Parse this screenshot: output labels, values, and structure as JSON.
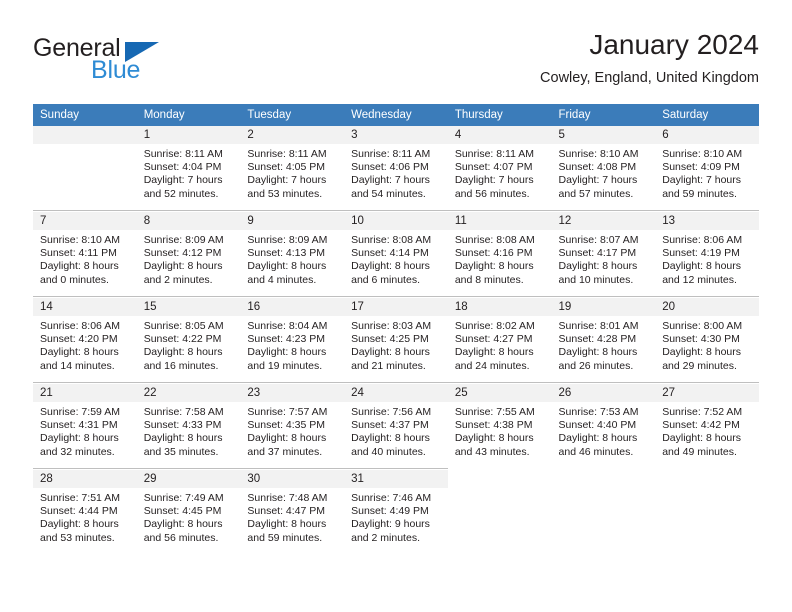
{
  "brand": {
    "name_dark": "General",
    "name_light": "Blue",
    "triangle_color": "#1668b3",
    "light_color": "#2e8bd4"
  },
  "header": {
    "title": "January 2024",
    "subtitle": "Cowley, England, United Kingdom",
    "header_bg": "#3b7cba",
    "daynum_bg": "#f2f2f2"
  },
  "weekday_headers": [
    "Sunday",
    "Monday",
    "Tuesday",
    "Wednesday",
    "Thursday",
    "Friday",
    "Saturday"
  ],
  "labels": {
    "sunrise_prefix": "Sunrise:",
    "sunset_prefix": "Sunset:",
    "daylight_prefix": "Daylight:"
  },
  "weeks": [
    [
      {
        "day": "",
        "sunrise": "",
        "sunset": "",
        "daylight_line1": "",
        "daylight_line2": "",
        "empty": true
      },
      {
        "day": "1",
        "sunrise": "Sunrise: 8:11 AM",
        "sunset": "Sunset: 4:04 PM",
        "daylight_line1": "Daylight: 7 hours",
        "daylight_line2": "and 52 minutes."
      },
      {
        "day": "2",
        "sunrise": "Sunrise: 8:11 AM",
        "sunset": "Sunset: 4:05 PM",
        "daylight_line1": "Daylight: 7 hours",
        "daylight_line2": "and 53 minutes."
      },
      {
        "day": "3",
        "sunrise": "Sunrise: 8:11 AM",
        "sunset": "Sunset: 4:06 PM",
        "daylight_line1": "Daylight: 7 hours",
        "daylight_line2": "and 54 minutes."
      },
      {
        "day": "4",
        "sunrise": "Sunrise: 8:11 AM",
        "sunset": "Sunset: 4:07 PM",
        "daylight_line1": "Daylight: 7 hours",
        "daylight_line2": "and 56 minutes."
      },
      {
        "day": "5",
        "sunrise": "Sunrise: 8:10 AM",
        "sunset": "Sunset: 4:08 PM",
        "daylight_line1": "Daylight: 7 hours",
        "daylight_line2": "and 57 minutes."
      },
      {
        "day": "6",
        "sunrise": "Sunrise: 8:10 AM",
        "sunset": "Sunset: 4:09 PM",
        "daylight_line1": "Daylight: 7 hours",
        "daylight_line2": "and 59 minutes."
      }
    ],
    [
      {
        "day": "7",
        "sunrise": "Sunrise: 8:10 AM",
        "sunset": "Sunset: 4:11 PM",
        "daylight_line1": "Daylight: 8 hours",
        "daylight_line2": "and 0 minutes."
      },
      {
        "day": "8",
        "sunrise": "Sunrise: 8:09 AM",
        "sunset": "Sunset: 4:12 PM",
        "daylight_line1": "Daylight: 8 hours",
        "daylight_line2": "and 2 minutes."
      },
      {
        "day": "9",
        "sunrise": "Sunrise: 8:09 AM",
        "sunset": "Sunset: 4:13 PM",
        "daylight_line1": "Daylight: 8 hours",
        "daylight_line2": "and 4 minutes."
      },
      {
        "day": "10",
        "sunrise": "Sunrise: 8:08 AM",
        "sunset": "Sunset: 4:14 PM",
        "daylight_line1": "Daylight: 8 hours",
        "daylight_line2": "and 6 minutes."
      },
      {
        "day": "11",
        "sunrise": "Sunrise: 8:08 AM",
        "sunset": "Sunset: 4:16 PM",
        "daylight_line1": "Daylight: 8 hours",
        "daylight_line2": "and 8 minutes."
      },
      {
        "day": "12",
        "sunrise": "Sunrise: 8:07 AM",
        "sunset": "Sunset: 4:17 PM",
        "daylight_line1": "Daylight: 8 hours",
        "daylight_line2": "and 10 minutes."
      },
      {
        "day": "13",
        "sunrise": "Sunrise: 8:06 AM",
        "sunset": "Sunset: 4:19 PM",
        "daylight_line1": "Daylight: 8 hours",
        "daylight_line2": "and 12 minutes."
      }
    ],
    [
      {
        "day": "14",
        "sunrise": "Sunrise: 8:06 AM",
        "sunset": "Sunset: 4:20 PM",
        "daylight_line1": "Daylight: 8 hours",
        "daylight_line2": "and 14 minutes."
      },
      {
        "day": "15",
        "sunrise": "Sunrise: 8:05 AM",
        "sunset": "Sunset: 4:22 PM",
        "daylight_line1": "Daylight: 8 hours",
        "daylight_line2": "and 16 minutes."
      },
      {
        "day": "16",
        "sunrise": "Sunrise: 8:04 AM",
        "sunset": "Sunset: 4:23 PM",
        "daylight_line1": "Daylight: 8 hours",
        "daylight_line2": "and 19 minutes."
      },
      {
        "day": "17",
        "sunrise": "Sunrise: 8:03 AM",
        "sunset": "Sunset: 4:25 PM",
        "daylight_line1": "Daylight: 8 hours",
        "daylight_line2": "and 21 minutes."
      },
      {
        "day": "18",
        "sunrise": "Sunrise: 8:02 AM",
        "sunset": "Sunset: 4:27 PM",
        "daylight_line1": "Daylight: 8 hours",
        "daylight_line2": "and 24 minutes."
      },
      {
        "day": "19",
        "sunrise": "Sunrise: 8:01 AM",
        "sunset": "Sunset: 4:28 PM",
        "daylight_line1": "Daylight: 8 hours",
        "daylight_line2": "and 26 minutes."
      },
      {
        "day": "20",
        "sunrise": "Sunrise: 8:00 AM",
        "sunset": "Sunset: 4:30 PM",
        "daylight_line1": "Daylight: 8 hours",
        "daylight_line2": "and 29 minutes."
      }
    ],
    [
      {
        "day": "21",
        "sunrise": "Sunrise: 7:59 AM",
        "sunset": "Sunset: 4:31 PM",
        "daylight_line1": "Daylight: 8 hours",
        "daylight_line2": "and 32 minutes."
      },
      {
        "day": "22",
        "sunrise": "Sunrise: 7:58 AM",
        "sunset": "Sunset: 4:33 PM",
        "daylight_line1": "Daylight: 8 hours",
        "daylight_line2": "and 35 minutes."
      },
      {
        "day": "23",
        "sunrise": "Sunrise: 7:57 AM",
        "sunset": "Sunset: 4:35 PM",
        "daylight_line1": "Daylight: 8 hours",
        "daylight_line2": "and 37 minutes."
      },
      {
        "day": "24",
        "sunrise": "Sunrise: 7:56 AM",
        "sunset": "Sunset: 4:37 PM",
        "daylight_line1": "Daylight: 8 hours",
        "daylight_line2": "and 40 minutes."
      },
      {
        "day": "25",
        "sunrise": "Sunrise: 7:55 AM",
        "sunset": "Sunset: 4:38 PM",
        "daylight_line1": "Daylight: 8 hours",
        "daylight_line2": "and 43 minutes."
      },
      {
        "day": "26",
        "sunrise": "Sunrise: 7:53 AM",
        "sunset": "Sunset: 4:40 PM",
        "daylight_line1": "Daylight: 8 hours",
        "daylight_line2": "and 46 minutes."
      },
      {
        "day": "27",
        "sunrise": "Sunrise: 7:52 AM",
        "sunset": "Sunset: 4:42 PM",
        "daylight_line1": "Daylight: 8 hours",
        "daylight_line2": "and 49 minutes."
      }
    ],
    [
      {
        "day": "28",
        "sunrise": "Sunrise: 7:51 AM",
        "sunset": "Sunset: 4:44 PM",
        "daylight_line1": "Daylight: 8 hours",
        "daylight_line2": "and 53 minutes."
      },
      {
        "day": "29",
        "sunrise": "Sunrise: 7:49 AM",
        "sunset": "Sunset: 4:45 PM",
        "daylight_line1": "Daylight: 8 hours",
        "daylight_line2": "and 56 minutes."
      },
      {
        "day": "30",
        "sunrise": "Sunrise: 7:48 AM",
        "sunset": "Sunset: 4:47 PM",
        "daylight_line1": "Daylight: 8 hours",
        "daylight_line2": "and 59 minutes."
      },
      {
        "day": "31",
        "sunrise": "Sunrise: 7:46 AM",
        "sunset": "Sunset: 4:49 PM",
        "daylight_line1": "Daylight: 9 hours",
        "daylight_line2": "and 2 minutes."
      },
      {
        "day": "",
        "sunrise": "",
        "sunset": "",
        "daylight_line1": "",
        "daylight_line2": "",
        "void": true
      },
      {
        "day": "",
        "sunrise": "",
        "sunset": "",
        "daylight_line1": "",
        "daylight_line2": "",
        "void": true
      },
      {
        "day": "",
        "sunrise": "",
        "sunset": "",
        "daylight_line1": "",
        "daylight_line2": "",
        "void": true
      }
    ]
  ]
}
